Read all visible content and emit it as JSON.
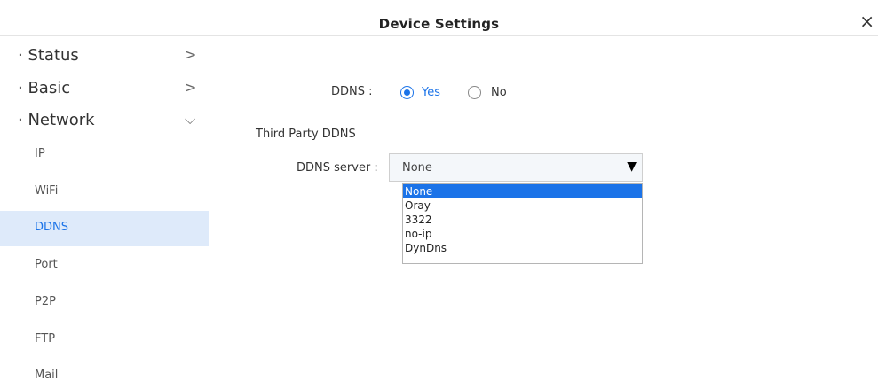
{
  "window": {
    "title": "Device Settings",
    "close_icon": "×"
  },
  "sidebar": {
    "sections": [
      {
        "label": "· Status",
        "chevron": ">"
      },
      {
        "label": "· Basic",
        "chevron": ">"
      },
      {
        "label": "· Network",
        "chevron": "⌵"
      }
    ],
    "network_items": [
      {
        "label": "IP"
      },
      {
        "label": "WiFi"
      },
      {
        "label": "DDNS",
        "active": true
      },
      {
        "label": "Port"
      },
      {
        "label": "P2P"
      },
      {
        "label": "FTP"
      },
      {
        "label": "Mail"
      }
    ]
  },
  "form": {
    "ddns_label": "DDNS :",
    "ddns_options": {
      "yes": "Yes",
      "no": "No",
      "selected": "Yes"
    },
    "section_title": "Third Party DDNS",
    "server_label": "DDNS server :",
    "server_value": "None",
    "dropdown_arrow": "▼",
    "server_options": [
      "None",
      "Oray",
      "3322",
      "no-ip",
      "DynDns"
    ]
  },
  "colors": {
    "accent": "#1b73e8",
    "active_bg": "#deeafa"
  }
}
